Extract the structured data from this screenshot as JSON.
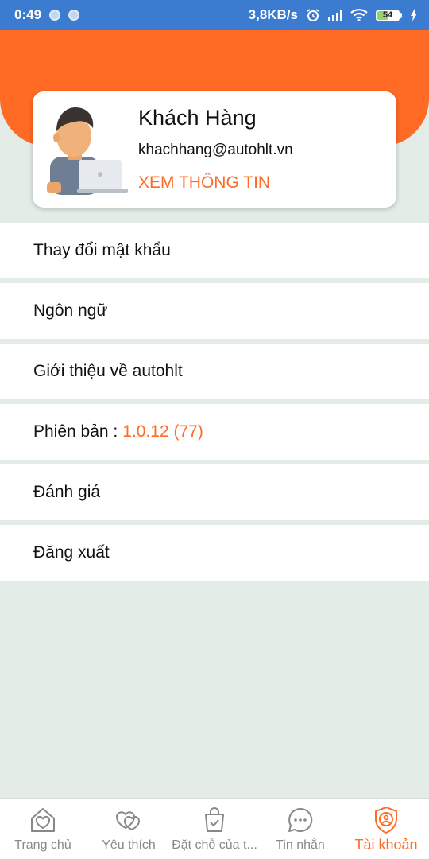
{
  "status_bar": {
    "time": "0:49",
    "speed": "3,8KB/s",
    "battery": "54"
  },
  "profile": {
    "name": "Khách Hàng",
    "email": "khachhang@autohlt.vn",
    "view_info": "XEM THÔNG TIN"
  },
  "menu": {
    "change_password": "Thay đổi mật khẩu",
    "language": "Ngôn ngữ",
    "about": "Giới thiệu về autohlt",
    "version_label": "Phiên bản :",
    "version_number": "1.0.12 (77)",
    "rate": "Đánh giá",
    "logout": "Đăng xuất"
  },
  "bottom_nav": {
    "items": [
      {
        "label": "Trang chủ",
        "icon": "home-heart-icon"
      },
      {
        "label": "Yêu thích",
        "icon": "heart-icon"
      },
      {
        "label": "Đặt chỗ của t...",
        "icon": "shopping-bag-check-icon"
      },
      {
        "label": "Tin nhắn",
        "icon": "chat-bubble-icon"
      },
      {
        "label": "Tài khoản",
        "icon": "account-shield-icon"
      }
    ],
    "active": "Tài khoản"
  },
  "colors": {
    "accent": "#ff6a25",
    "status_bar": "#3b7bd0",
    "background": "#e3ece6"
  }
}
